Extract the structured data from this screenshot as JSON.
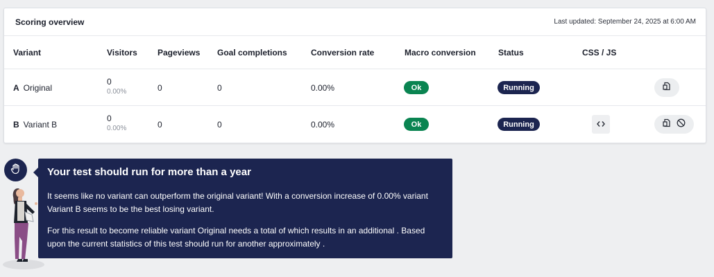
{
  "header": {
    "title": "Scoring overview",
    "last_updated": "Last updated: September 24, 2025 at 6:00 AM"
  },
  "table": {
    "columns": [
      "Variant",
      "Visitors",
      "Pageviews",
      "Goal completions",
      "Conversion rate",
      "Macro conversion",
      "Status",
      "CSS / JS"
    ],
    "rows": [
      {
        "letter": "A",
        "name": "Original",
        "visitors": "0",
        "visitors_pct": "0.00%",
        "pageviews": "0",
        "goals": "0",
        "conversion": "0.00%",
        "macro": "Ok",
        "status": "Running"
      },
      {
        "letter": "B",
        "name": "Variant B",
        "visitors": "0",
        "visitors_pct": "0.00%",
        "pageviews": "0",
        "goals": "0",
        "conversion": "0.00%",
        "macro": "Ok",
        "status": "Running"
      }
    ]
  },
  "tip": {
    "title": "Your test should run for more than a year",
    "paragraph1": "It seems like no variant can outperform the original variant! With a conversion increase of 0.00% variant Variant B seems to be the best losing variant.",
    "paragraph2": "For this result to become reliable variant Original needs a total of which results in an additional . Based upon the current statistics of this test should run for another approximately ."
  },
  "colors": {
    "navy": "#1c2550",
    "ok_green": "#0a8451",
    "background": "#eeeff1"
  },
  "icons": [
    "copy-icon",
    "code-icon",
    "disable-icon",
    "hand-icon"
  ]
}
